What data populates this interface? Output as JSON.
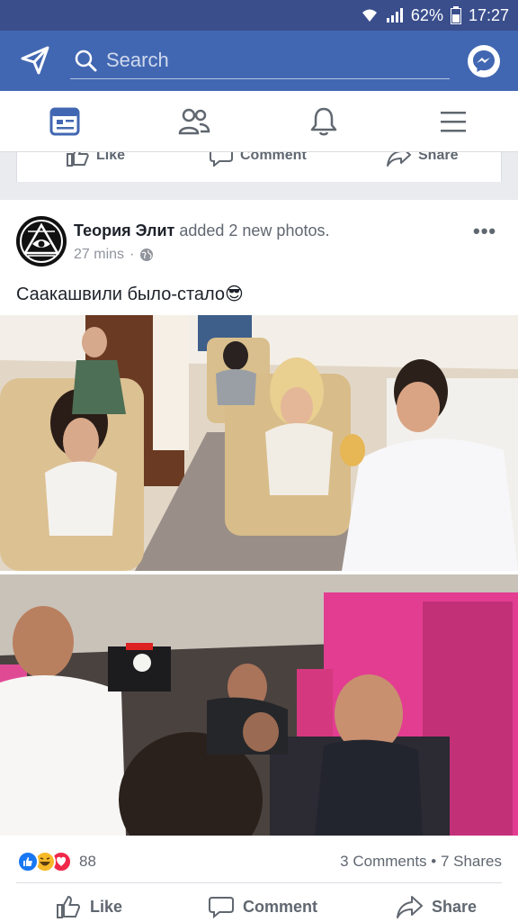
{
  "status": {
    "battery": "62%",
    "time": "17:27"
  },
  "search": {
    "placeholder": "Search"
  },
  "previous_post": {
    "like": "Like",
    "comment": "Comment",
    "share": "Share"
  },
  "post": {
    "author": "Теория Элит",
    "action": " added 2 new photos.",
    "time": "27 mins",
    "dot": "·",
    "caption": "Саакашвили было-стало😎",
    "reaction_count": "88",
    "comments": "3 Comments",
    "shares": "7 Shares",
    "sep": " • "
  },
  "actions": {
    "like": "Like",
    "comment": "Comment",
    "share": "Share"
  },
  "icons": {
    "send": "send-icon",
    "search": "search-icon",
    "messenger": "messenger-icon",
    "news": "news-feed-icon",
    "friends": "friends-icon",
    "bell": "notifications-icon",
    "menu": "menu-icon",
    "globe": "globe-icon"
  },
  "colors": {
    "brand": "#4267b2",
    "status": "#3a4e8c",
    "like": "#1877f2",
    "haha": "#f7b928",
    "love": "#f0284a"
  }
}
